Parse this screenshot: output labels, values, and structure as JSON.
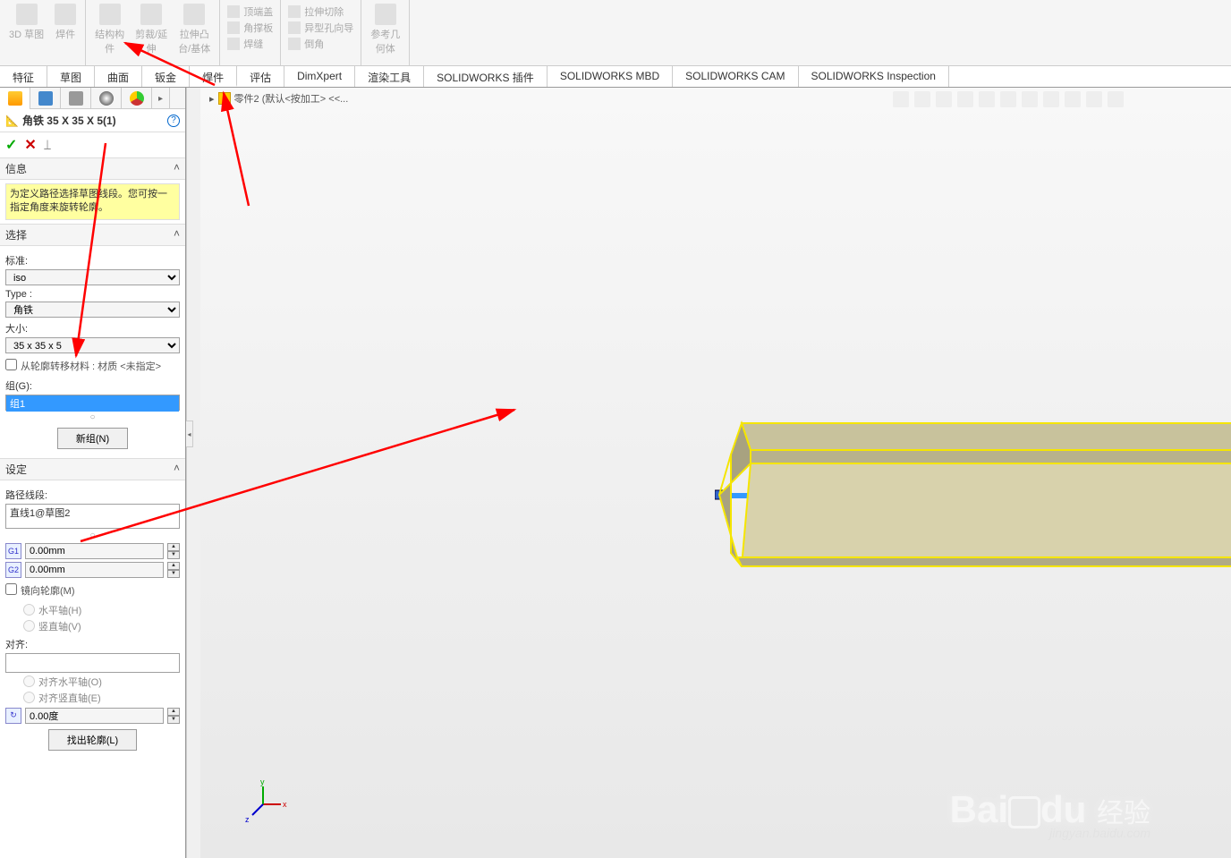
{
  "ribbon": {
    "groups": [
      {
        "btns": [
          {
            "label": "3D 草图"
          },
          {
            "label": "焊件"
          }
        ]
      },
      {
        "btns": [
          {
            "label": "结构构\n件"
          },
          {
            "label": "剪裁/延\n伸"
          },
          {
            "label": "拉伸凸\n台/基体"
          }
        ]
      },
      {
        "rows": [
          {
            "label": "顶端盖"
          },
          {
            "label": "角撑板"
          },
          {
            "label": "焊缝"
          }
        ]
      },
      {
        "rows": [
          {
            "label": "拉伸切除"
          },
          {
            "label": "异型孔向导"
          },
          {
            "label": "倒角"
          }
        ]
      },
      {
        "btns": [
          {
            "label": "参考几\n何体"
          }
        ]
      }
    ]
  },
  "tabs": [
    "特征",
    "草图",
    "曲面",
    "钣金",
    "焊件",
    "评估",
    "DimXpert",
    "渲染工具",
    "SOLIDWORKS 插件",
    "SOLIDWORKS MBD",
    "SOLIDWORKS CAM",
    "SOLIDWORKS Inspection"
  ],
  "active_tab": 4,
  "panel": {
    "title": "角铁 35 X 35 X 5(1)",
    "info_head": "信息",
    "info_text": "为定义路径选择草图线段。您可按一指定角度来旋转轮廓。",
    "select_head": "选择",
    "standard_label": "标准:",
    "standard_value": "iso",
    "type_label": "Type :",
    "type_value": "角铁",
    "size_label": "大小:",
    "size_value": "35 x 35 x 5",
    "material_check": "从轮廓转移材料 : 材质 <未指定>",
    "group_label": "组(G):",
    "group_item": "组1",
    "new_group_btn": "新组(N)",
    "settings_head": "设定",
    "path_label": "路径线段:",
    "path_item": "直线1@草图2",
    "g1_value": "0.00mm",
    "g2_value": "0.00mm",
    "mirror_check": "镜向轮廓(M)",
    "horiz_axis": "水平轴(H)",
    "vert_axis": "竖直轴(V)",
    "align_label": "对齐:",
    "align_horiz": "对齐水平轴(O)",
    "align_vert": "对齐竖直轴(E)",
    "angle_value": "0.00度",
    "find_profile_btn": "找出轮廓(L)"
  },
  "breadcrumb": {
    "part": "零件2  (默认<按加工> <<..."
  },
  "triad": {
    "x": "x",
    "y": "y",
    "z": "z"
  },
  "watermark": {
    "brand": "Baidu",
    "cn": "经验",
    "url": "jingyan.baidu.com"
  }
}
